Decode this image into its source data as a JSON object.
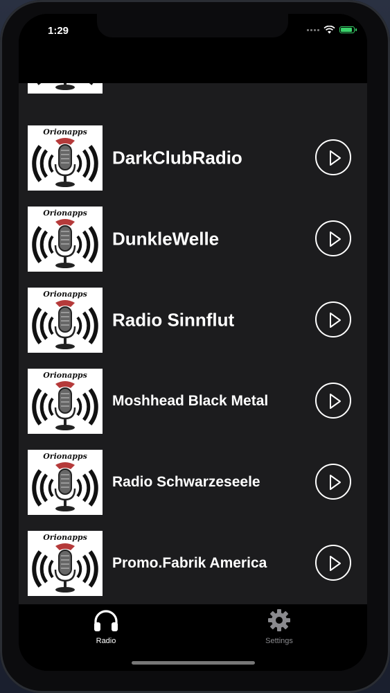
{
  "status_bar": {
    "time": "1:29"
  },
  "stations": [
    {
      "name": "",
      "size": "big"
    },
    {
      "name": "DarkClubRadio",
      "size": "big"
    },
    {
      "name": "DunkleWelle",
      "size": "big"
    },
    {
      "name": "Radio Sinnflut",
      "size": "big"
    },
    {
      "name": "Moshhead Black Metal",
      "size": "med"
    },
    {
      "name": "Radio Schwarzeseele",
      "size": "med"
    },
    {
      "name": "Promo.Fabrik America",
      "size": "med"
    }
  ],
  "thumbnail_brand": "Orionapps",
  "tabs": [
    {
      "label": "Radio",
      "icon": "headphones-icon",
      "active": true
    },
    {
      "label": "Settings",
      "icon": "gear-icon",
      "active": false
    }
  ],
  "colors": {
    "list_background": "#1c1c1e",
    "active_tab": "#ffffff",
    "inactive_tab": "#8a8a8e",
    "battery": "#3ad36b"
  }
}
